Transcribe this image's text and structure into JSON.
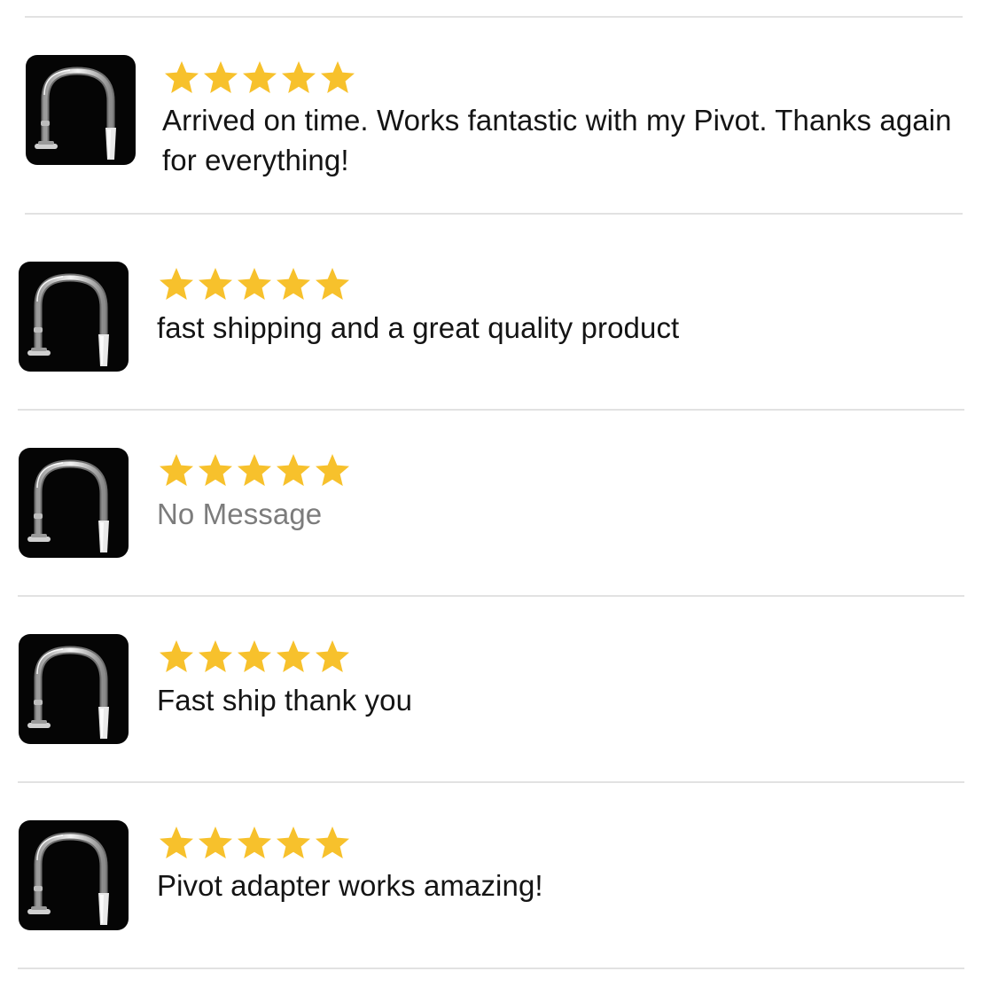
{
  "colors": {
    "star": "#F7C12C",
    "divider": "#E2E2E2",
    "thumb_bg": "#050505",
    "text": "#141414",
    "muted_text": "#7C7C7C"
  },
  "reviews": [
    {
      "rating": 5,
      "message": "Arrived on time. Works fantastic with my Pivot. Thanks again for everything!",
      "thumbnail_icon": "glass-adapter-product-image"
    },
    {
      "rating": 5,
      "message": "fast shipping and a great quality product",
      "thumbnail_icon": "glass-adapter-product-image"
    },
    {
      "rating": 5,
      "message": "No Message",
      "muted": true,
      "thumbnail_icon": "glass-adapter-product-image"
    },
    {
      "rating": 5,
      "message": "Fast ship thank you",
      "thumbnail_icon": "glass-adapter-product-image"
    },
    {
      "rating": 5,
      "message": "Pivot adapter works amazing!",
      "thumbnail_icon": "glass-adapter-product-image"
    }
  ]
}
